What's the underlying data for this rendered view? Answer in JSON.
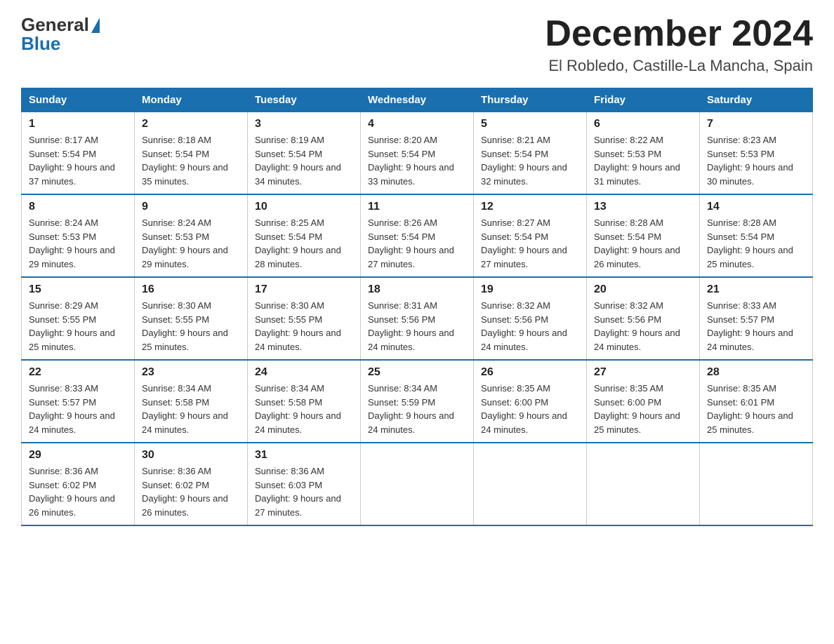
{
  "logo": {
    "general": "General",
    "blue": "Blue"
  },
  "title": "December 2024",
  "location": "El Robledo, Castille-La Mancha, Spain",
  "headers": [
    "Sunday",
    "Monday",
    "Tuesday",
    "Wednesday",
    "Thursday",
    "Friday",
    "Saturday"
  ],
  "weeks": [
    [
      {
        "day": "1",
        "sunrise": "8:17 AM",
        "sunset": "5:54 PM",
        "daylight": "9 hours and 37 minutes."
      },
      {
        "day": "2",
        "sunrise": "8:18 AM",
        "sunset": "5:54 PM",
        "daylight": "9 hours and 35 minutes."
      },
      {
        "day": "3",
        "sunrise": "8:19 AM",
        "sunset": "5:54 PM",
        "daylight": "9 hours and 34 minutes."
      },
      {
        "day": "4",
        "sunrise": "8:20 AM",
        "sunset": "5:54 PM",
        "daylight": "9 hours and 33 minutes."
      },
      {
        "day": "5",
        "sunrise": "8:21 AM",
        "sunset": "5:54 PM",
        "daylight": "9 hours and 32 minutes."
      },
      {
        "day": "6",
        "sunrise": "8:22 AM",
        "sunset": "5:53 PM",
        "daylight": "9 hours and 31 minutes."
      },
      {
        "day": "7",
        "sunrise": "8:23 AM",
        "sunset": "5:53 PM",
        "daylight": "9 hours and 30 minutes."
      }
    ],
    [
      {
        "day": "8",
        "sunrise": "8:24 AM",
        "sunset": "5:53 PM",
        "daylight": "9 hours and 29 minutes."
      },
      {
        "day": "9",
        "sunrise": "8:24 AM",
        "sunset": "5:53 PM",
        "daylight": "9 hours and 29 minutes."
      },
      {
        "day": "10",
        "sunrise": "8:25 AM",
        "sunset": "5:54 PM",
        "daylight": "9 hours and 28 minutes."
      },
      {
        "day": "11",
        "sunrise": "8:26 AM",
        "sunset": "5:54 PM",
        "daylight": "9 hours and 27 minutes."
      },
      {
        "day": "12",
        "sunrise": "8:27 AM",
        "sunset": "5:54 PM",
        "daylight": "9 hours and 27 minutes."
      },
      {
        "day": "13",
        "sunrise": "8:28 AM",
        "sunset": "5:54 PM",
        "daylight": "9 hours and 26 minutes."
      },
      {
        "day": "14",
        "sunrise": "8:28 AM",
        "sunset": "5:54 PM",
        "daylight": "9 hours and 25 minutes."
      }
    ],
    [
      {
        "day": "15",
        "sunrise": "8:29 AM",
        "sunset": "5:55 PM",
        "daylight": "9 hours and 25 minutes."
      },
      {
        "day": "16",
        "sunrise": "8:30 AM",
        "sunset": "5:55 PM",
        "daylight": "9 hours and 25 minutes."
      },
      {
        "day": "17",
        "sunrise": "8:30 AM",
        "sunset": "5:55 PM",
        "daylight": "9 hours and 24 minutes."
      },
      {
        "day": "18",
        "sunrise": "8:31 AM",
        "sunset": "5:56 PM",
        "daylight": "9 hours and 24 minutes."
      },
      {
        "day": "19",
        "sunrise": "8:32 AM",
        "sunset": "5:56 PM",
        "daylight": "9 hours and 24 minutes."
      },
      {
        "day": "20",
        "sunrise": "8:32 AM",
        "sunset": "5:56 PM",
        "daylight": "9 hours and 24 minutes."
      },
      {
        "day": "21",
        "sunrise": "8:33 AM",
        "sunset": "5:57 PM",
        "daylight": "9 hours and 24 minutes."
      }
    ],
    [
      {
        "day": "22",
        "sunrise": "8:33 AM",
        "sunset": "5:57 PM",
        "daylight": "9 hours and 24 minutes."
      },
      {
        "day": "23",
        "sunrise": "8:34 AM",
        "sunset": "5:58 PM",
        "daylight": "9 hours and 24 minutes."
      },
      {
        "day": "24",
        "sunrise": "8:34 AM",
        "sunset": "5:58 PM",
        "daylight": "9 hours and 24 minutes."
      },
      {
        "day": "25",
        "sunrise": "8:34 AM",
        "sunset": "5:59 PM",
        "daylight": "9 hours and 24 minutes."
      },
      {
        "day": "26",
        "sunrise": "8:35 AM",
        "sunset": "6:00 PM",
        "daylight": "9 hours and 24 minutes."
      },
      {
        "day": "27",
        "sunrise": "8:35 AM",
        "sunset": "6:00 PM",
        "daylight": "9 hours and 25 minutes."
      },
      {
        "day": "28",
        "sunrise": "8:35 AM",
        "sunset": "6:01 PM",
        "daylight": "9 hours and 25 minutes."
      }
    ],
    [
      {
        "day": "29",
        "sunrise": "8:36 AM",
        "sunset": "6:02 PM",
        "daylight": "9 hours and 26 minutes."
      },
      {
        "day": "30",
        "sunrise": "8:36 AM",
        "sunset": "6:02 PM",
        "daylight": "9 hours and 26 minutes."
      },
      {
        "day": "31",
        "sunrise": "8:36 AM",
        "sunset": "6:03 PM",
        "daylight": "9 hours and 27 minutes."
      },
      null,
      null,
      null,
      null
    ]
  ]
}
